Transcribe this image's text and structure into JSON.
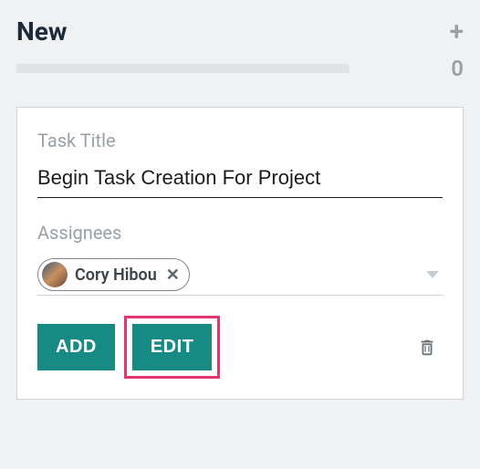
{
  "column": {
    "title": "New",
    "count": "0"
  },
  "card": {
    "titleLabel": "Task Title",
    "titleValue": "Begin Task Creation For Project",
    "assigneesLabel": "Assignees",
    "assignee": {
      "name": "Cory Hibou"
    },
    "addLabel": "ADD",
    "editLabel": "EDIT"
  }
}
